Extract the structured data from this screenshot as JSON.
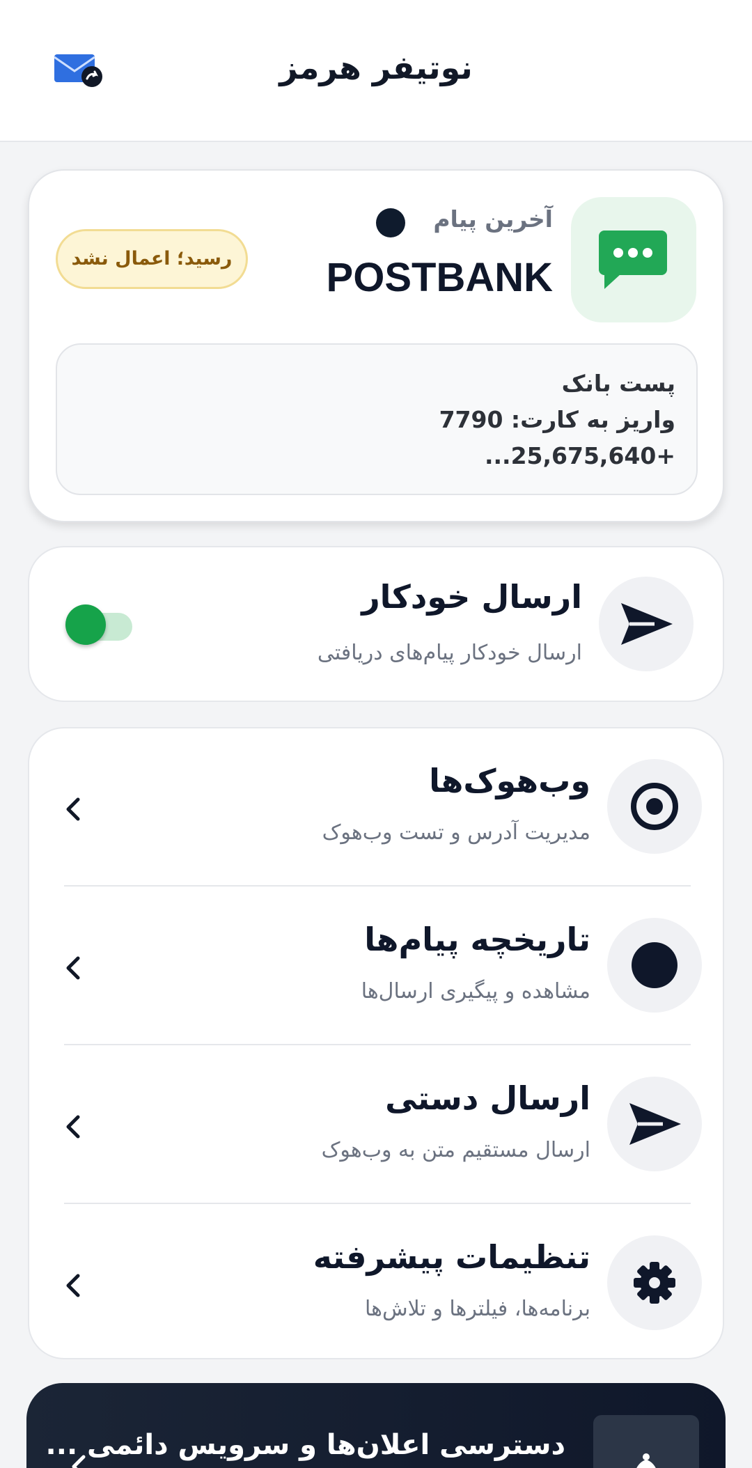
{
  "header": {
    "title": "نوتیفر هرمز",
    "mail_icon": "mail-sync-icon"
  },
  "last_message": {
    "label": "آخرین پیام",
    "sender": "POSTBANK",
    "receipt_status": "رسید؛ اعمال نشد",
    "lines": [
      "پست بانک",
      "واریز به کارت: 7790",
      "+25,675,640..."
    ],
    "app_icon": "chat-bubble-icon",
    "colors": {
      "app_icon_bg": "#e8f6ec",
      "app_icon": "#22a856",
      "badge_bg": "#fdf5d6",
      "badge_text": "#8a5a0b"
    }
  },
  "auto_send": {
    "title": "ارسال خودکار",
    "subtitle": "ارسال خودکار پیام‌های دریافتی",
    "enabled": true,
    "icon": "send-icon",
    "colors": {
      "toggle_on": "#16a34a"
    }
  },
  "menu": [
    {
      "title": "وب‌هوک‌ها",
      "subtitle": "مدیریت آدرس و تست وب‌هوک",
      "icon": "target-icon"
    },
    {
      "title": "تاریخچه پیام‌ها",
      "subtitle": "مشاهده و پیگیری ارسال‌ها",
      "icon": "history-dot-icon"
    },
    {
      "title": "ارسال دستی",
      "subtitle": "ارسال مستقیم متن به وب‌هوک",
      "icon": "send-icon"
    },
    {
      "title": "تنظیمات پیشرفته",
      "subtitle": "برنامه‌ها، فیلترها و تلاش‌ها",
      "icon": "gear-icon"
    }
  ],
  "banner": {
    "text": "دسترسی اعلان‌ها و سرویس دائمی ...",
    "icon": "bell-icon"
  }
}
